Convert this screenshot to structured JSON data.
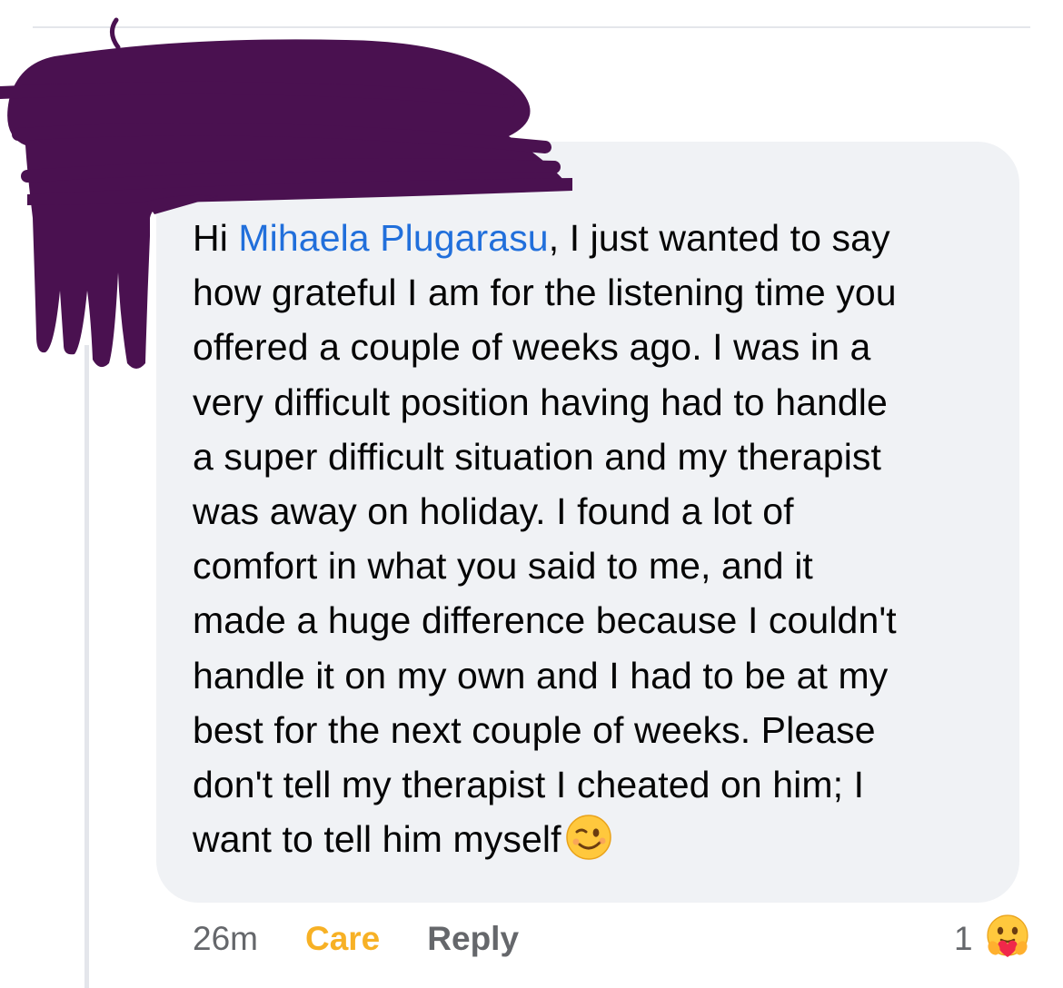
{
  "comment": {
    "greeting": "Hi ",
    "mention": "Mihaela Plugarasu",
    "line1_rest": ", I just wanted to say",
    "lines": [
      "how grateful I am for the listening time you",
      "offered a couple of weeks ago. I was in a",
      "very difficult position having had to handle",
      "a super difficult situation and my therapist",
      "was away on holiday. I found a lot of",
      "comfort in what you said to me, and it",
      "made a huge difference because I couldn't",
      "handle it on my own and I had to be at my",
      "best for the next couple of weeks. Please",
      "don't tell my therapist I cheated on him; I",
      "want to tell him myself"
    ],
    "trailing_emoji_icon": "winking-face-emoji-icon"
  },
  "meta": {
    "timestamp": "26m",
    "reaction_label": "Care",
    "reply_label": "Reply",
    "reaction_count": "1",
    "reaction_icon": "care-reaction-icon"
  },
  "colors": {
    "bubble_bg": "#f0f2f5",
    "mention": "#216fdb",
    "care": "#f7b125",
    "muted": "#65676b",
    "redaction": "#4a1150"
  }
}
